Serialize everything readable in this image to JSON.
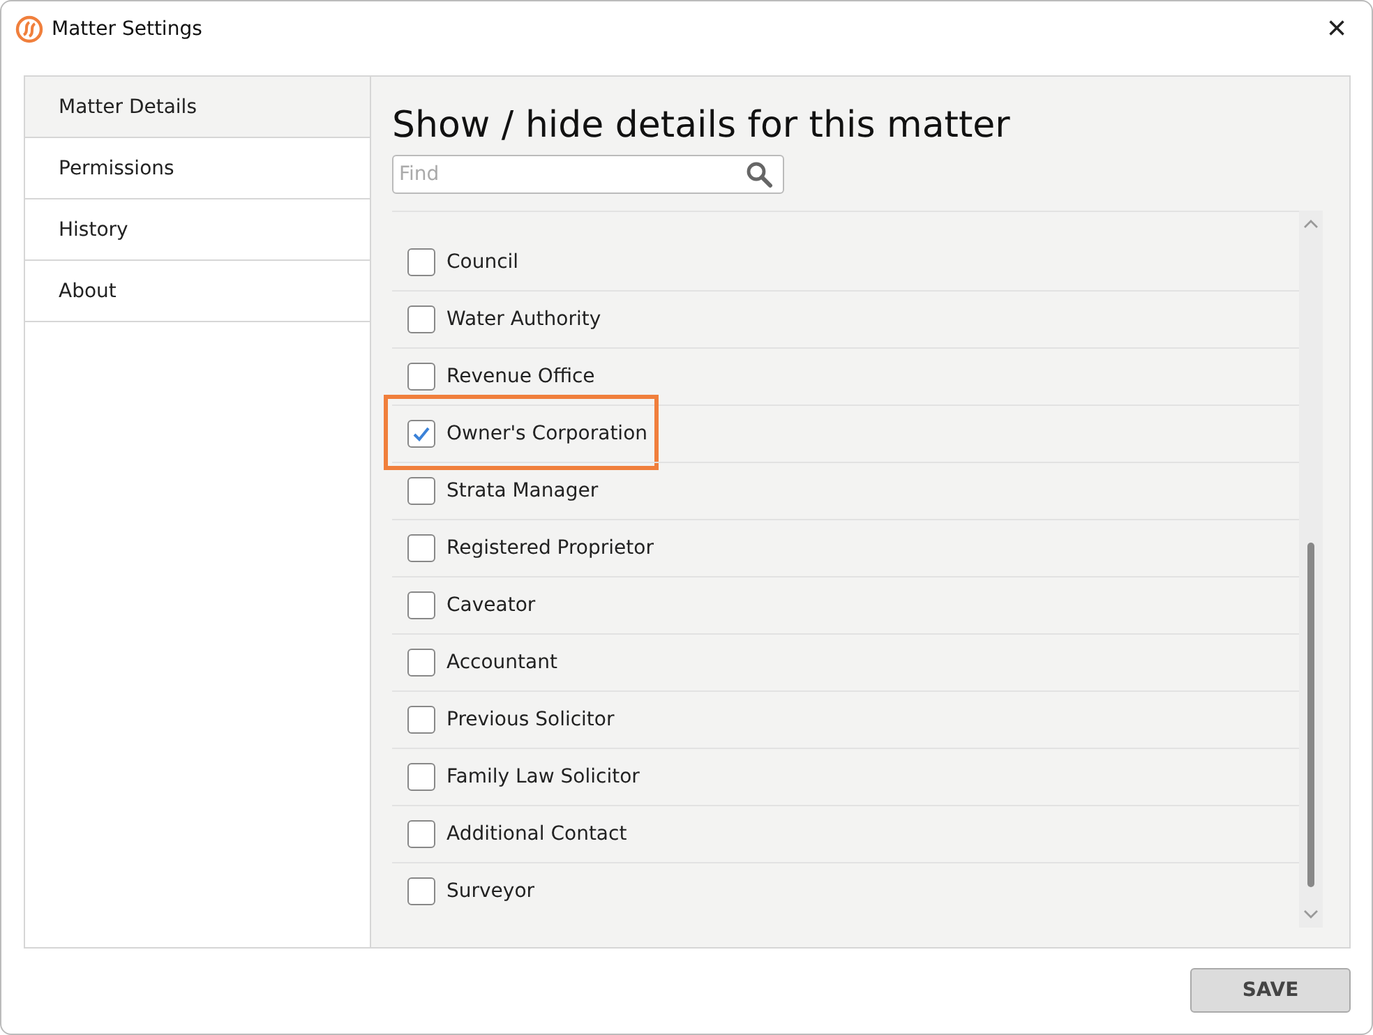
{
  "window": {
    "title": "Matter Settings",
    "close": "×"
  },
  "sidebar": {
    "items": [
      {
        "label": "Matter Details",
        "selected": true
      },
      {
        "label": "Permissions",
        "selected": false
      },
      {
        "label": "History",
        "selected": false
      },
      {
        "label": "About",
        "selected": false
      }
    ]
  },
  "heading": "Show / hide details for this matter",
  "search": {
    "placeholder": "Find"
  },
  "details": [
    {
      "label": "Council",
      "checked": false,
      "highlighted": false
    },
    {
      "label": "Water Authority",
      "checked": false,
      "highlighted": false
    },
    {
      "label": "Revenue Office",
      "checked": false,
      "highlighted": false
    },
    {
      "label": "Owner's Corporation",
      "checked": true,
      "highlighted": true
    },
    {
      "label": "Strata Manager",
      "checked": false,
      "highlighted": false
    },
    {
      "label": "Registered Proprietor",
      "checked": false,
      "highlighted": false
    },
    {
      "label": "Caveator",
      "checked": false,
      "highlighted": false
    },
    {
      "label": "Accountant",
      "checked": false,
      "highlighted": false
    },
    {
      "label": "Previous Solicitor",
      "checked": false,
      "highlighted": false
    },
    {
      "label": "Family Law Solicitor",
      "checked": false,
      "highlighted": false
    },
    {
      "label": "Additional Contact",
      "checked": false,
      "highlighted": false
    },
    {
      "label": "Surveyor",
      "checked": false,
      "highlighted": false
    }
  ],
  "buttons": [
    "SAVE"
  ]
}
